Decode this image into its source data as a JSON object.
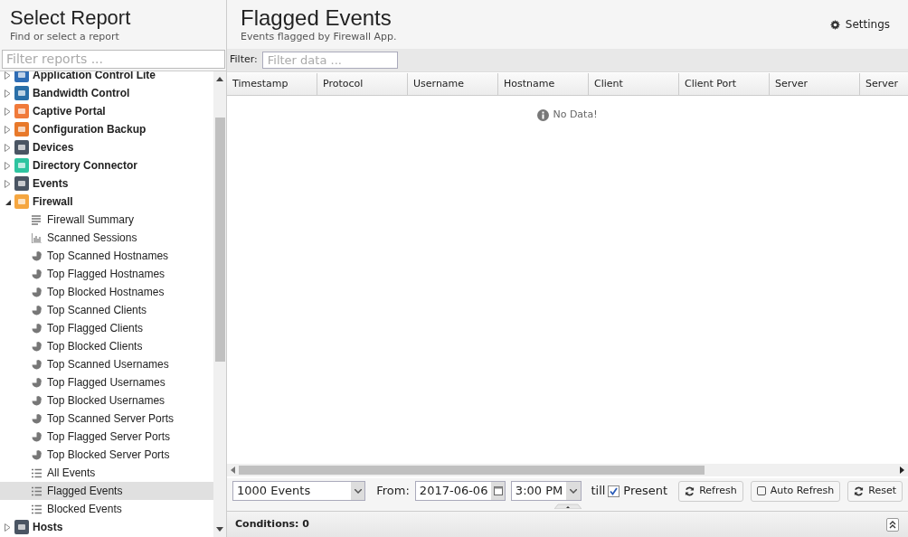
{
  "sidebar": {
    "title": "Select Report",
    "subtitle": "Find or select a report",
    "filter": {
      "placeholder": "Filter reports ..."
    },
    "items": [
      {
        "label": "Application Control Lite",
        "color": "#2f6db5",
        "expanded": false
      },
      {
        "label": "Bandwidth Control",
        "color": "#2a6fa8",
        "expanded": false
      },
      {
        "label": "Captive Portal",
        "color": "#f07a3a",
        "expanded": false
      },
      {
        "label": "Configuration Backup",
        "color": "#e8792a",
        "expanded": false
      },
      {
        "label": "Devices",
        "color": "#4a5563",
        "expanded": false
      },
      {
        "label": "Directory Connector",
        "color": "#2ec4a0",
        "expanded": false
      },
      {
        "label": "Events",
        "color": "#4a5563",
        "expanded": false
      },
      {
        "label": "Firewall",
        "color": "#f5a640",
        "expanded": true,
        "children": [
          {
            "label": "Firewall Summary",
            "kind": "text",
            "selected": false
          },
          {
            "label": "Scanned Sessions",
            "kind": "bars",
            "selected": false
          },
          {
            "label": "Top Scanned Hostnames",
            "kind": "pie",
            "selected": false
          },
          {
            "label": "Top Flagged Hostnames",
            "kind": "pie",
            "selected": false
          },
          {
            "label": "Top Blocked Hostnames",
            "kind": "pie",
            "selected": false
          },
          {
            "label": "Top Scanned Clients",
            "kind": "pie",
            "selected": false
          },
          {
            "label": "Top Flagged Clients",
            "kind": "pie",
            "selected": false
          },
          {
            "label": "Top Blocked Clients",
            "kind": "pie",
            "selected": false
          },
          {
            "label": "Top Scanned Usernames",
            "kind": "pie",
            "selected": false
          },
          {
            "label": "Top Flagged Usernames",
            "kind": "pie",
            "selected": false
          },
          {
            "label": "Top Blocked Usernames",
            "kind": "pie",
            "selected": false
          },
          {
            "label": "Top Scanned Server Ports",
            "kind": "pie",
            "selected": false
          },
          {
            "label": "Top Flagged Server Ports",
            "kind": "pie",
            "selected": false
          },
          {
            "label": "Top Blocked Server Ports",
            "kind": "pie",
            "selected": false
          },
          {
            "label": "All Events",
            "kind": "list",
            "selected": false
          },
          {
            "label": "Flagged Events",
            "kind": "list",
            "selected": true
          },
          {
            "label": "Blocked Events",
            "kind": "list",
            "selected": false
          }
        ]
      },
      {
        "label": "Hosts",
        "color": "#4a5563",
        "expanded": false
      }
    ]
  },
  "report": {
    "title": "Flagged Events",
    "subtitle": "Events flagged by Firewall App.",
    "settings": "Settings",
    "filter": {
      "label": "Filter:",
      "placeholder": "Filter data ..."
    },
    "columns": [
      "Timestamp",
      "Protocol",
      "Username",
      "Hostname",
      "Client",
      "Client Port",
      "Server",
      "Server"
    ],
    "empty": "No Data!",
    "toolbar": {
      "limit": "1000 Events",
      "from_label": "From:",
      "date": "2017-06-06",
      "time": "3:00 PM",
      "till": "till",
      "present": {
        "label": "Present",
        "checked": true
      },
      "refresh": "Refresh",
      "auto_refresh": {
        "label": "Auto Refresh",
        "checked": false
      },
      "reset": "Reset"
    },
    "conditions": "Conditions: 0"
  }
}
